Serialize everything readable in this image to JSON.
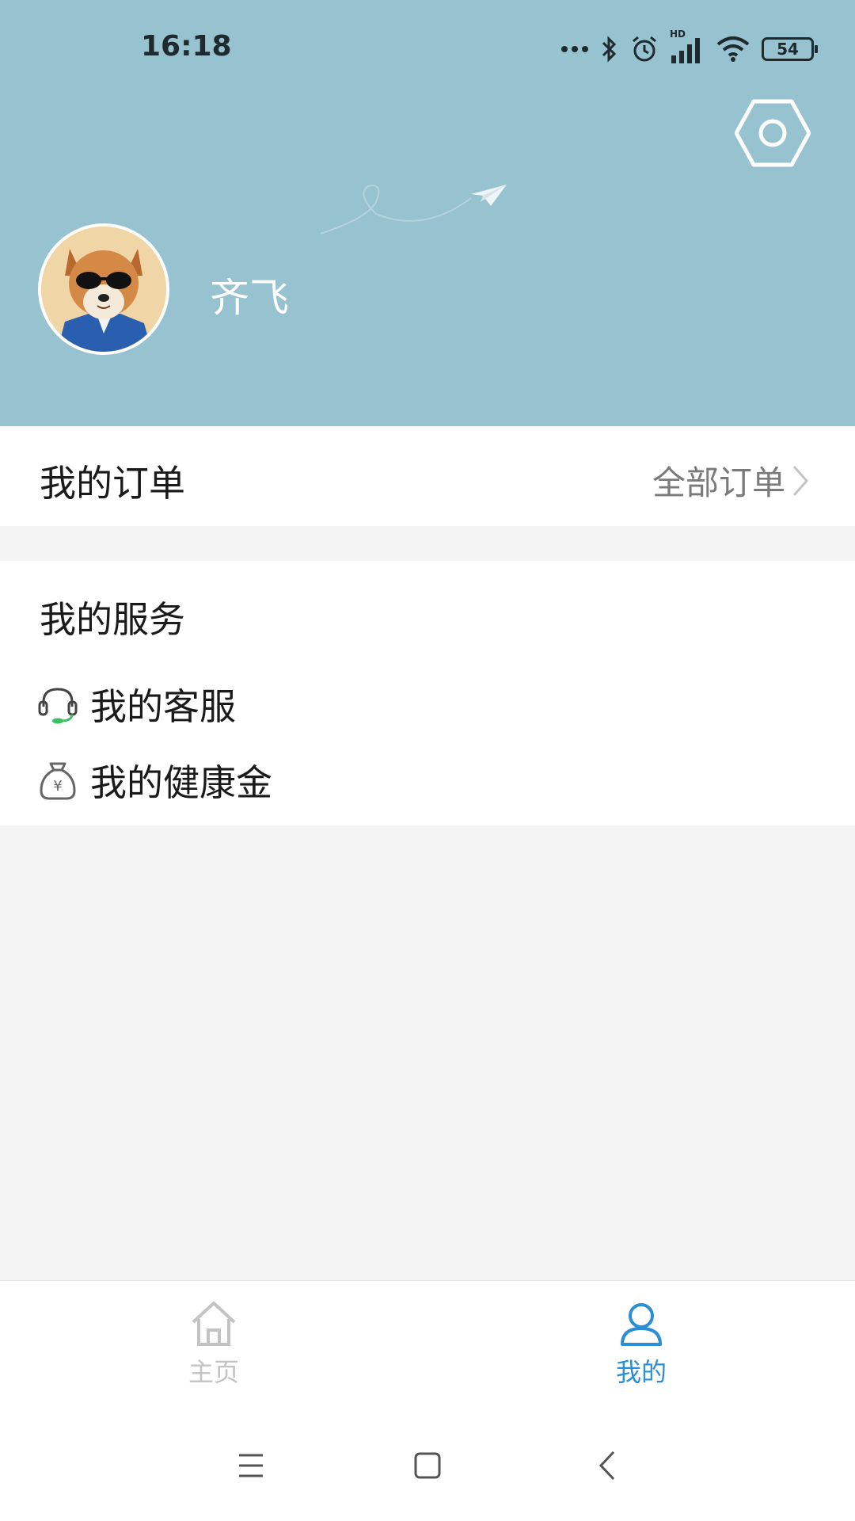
{
  "status_bar": {
    "time": "16:18",
    "battery": "54",
    "network_badge": "HD"
  },
  "header": {
    "username": "齐飞",
    "settings_icon": "hexagon-settings-icon",
    "decor_icon": "paper-plane-icon",
    "background_color": "#97c2d0"
  },
  "orders": {
    "title": "我的订单",
    "all_link": "全部订单"
  },
  "services": {
    "title": "我的服务",
    "items": [
      {
        "label": "我的客服",
        "icon": "headset-icon"
      },
      {
        "label": "我的健康金",
        "icon": "money-bag-icon"
      }
    ]
  },
  "tabbar": {
    "tabs": [
      {
        "label": "主页",
        "icon": "home-icon",
        "active": false
      },
      {
        "label": "我的",
        "icon": "user-icon",
        "active": true
      }
    ],
    "active_color": "#2b8fd6",
    "inactive_color": "#c3c3c3"
  },
  "system_nav": {
    "buttons": [
      "menu",
      "home",
      "back"
    ]
  }
}
